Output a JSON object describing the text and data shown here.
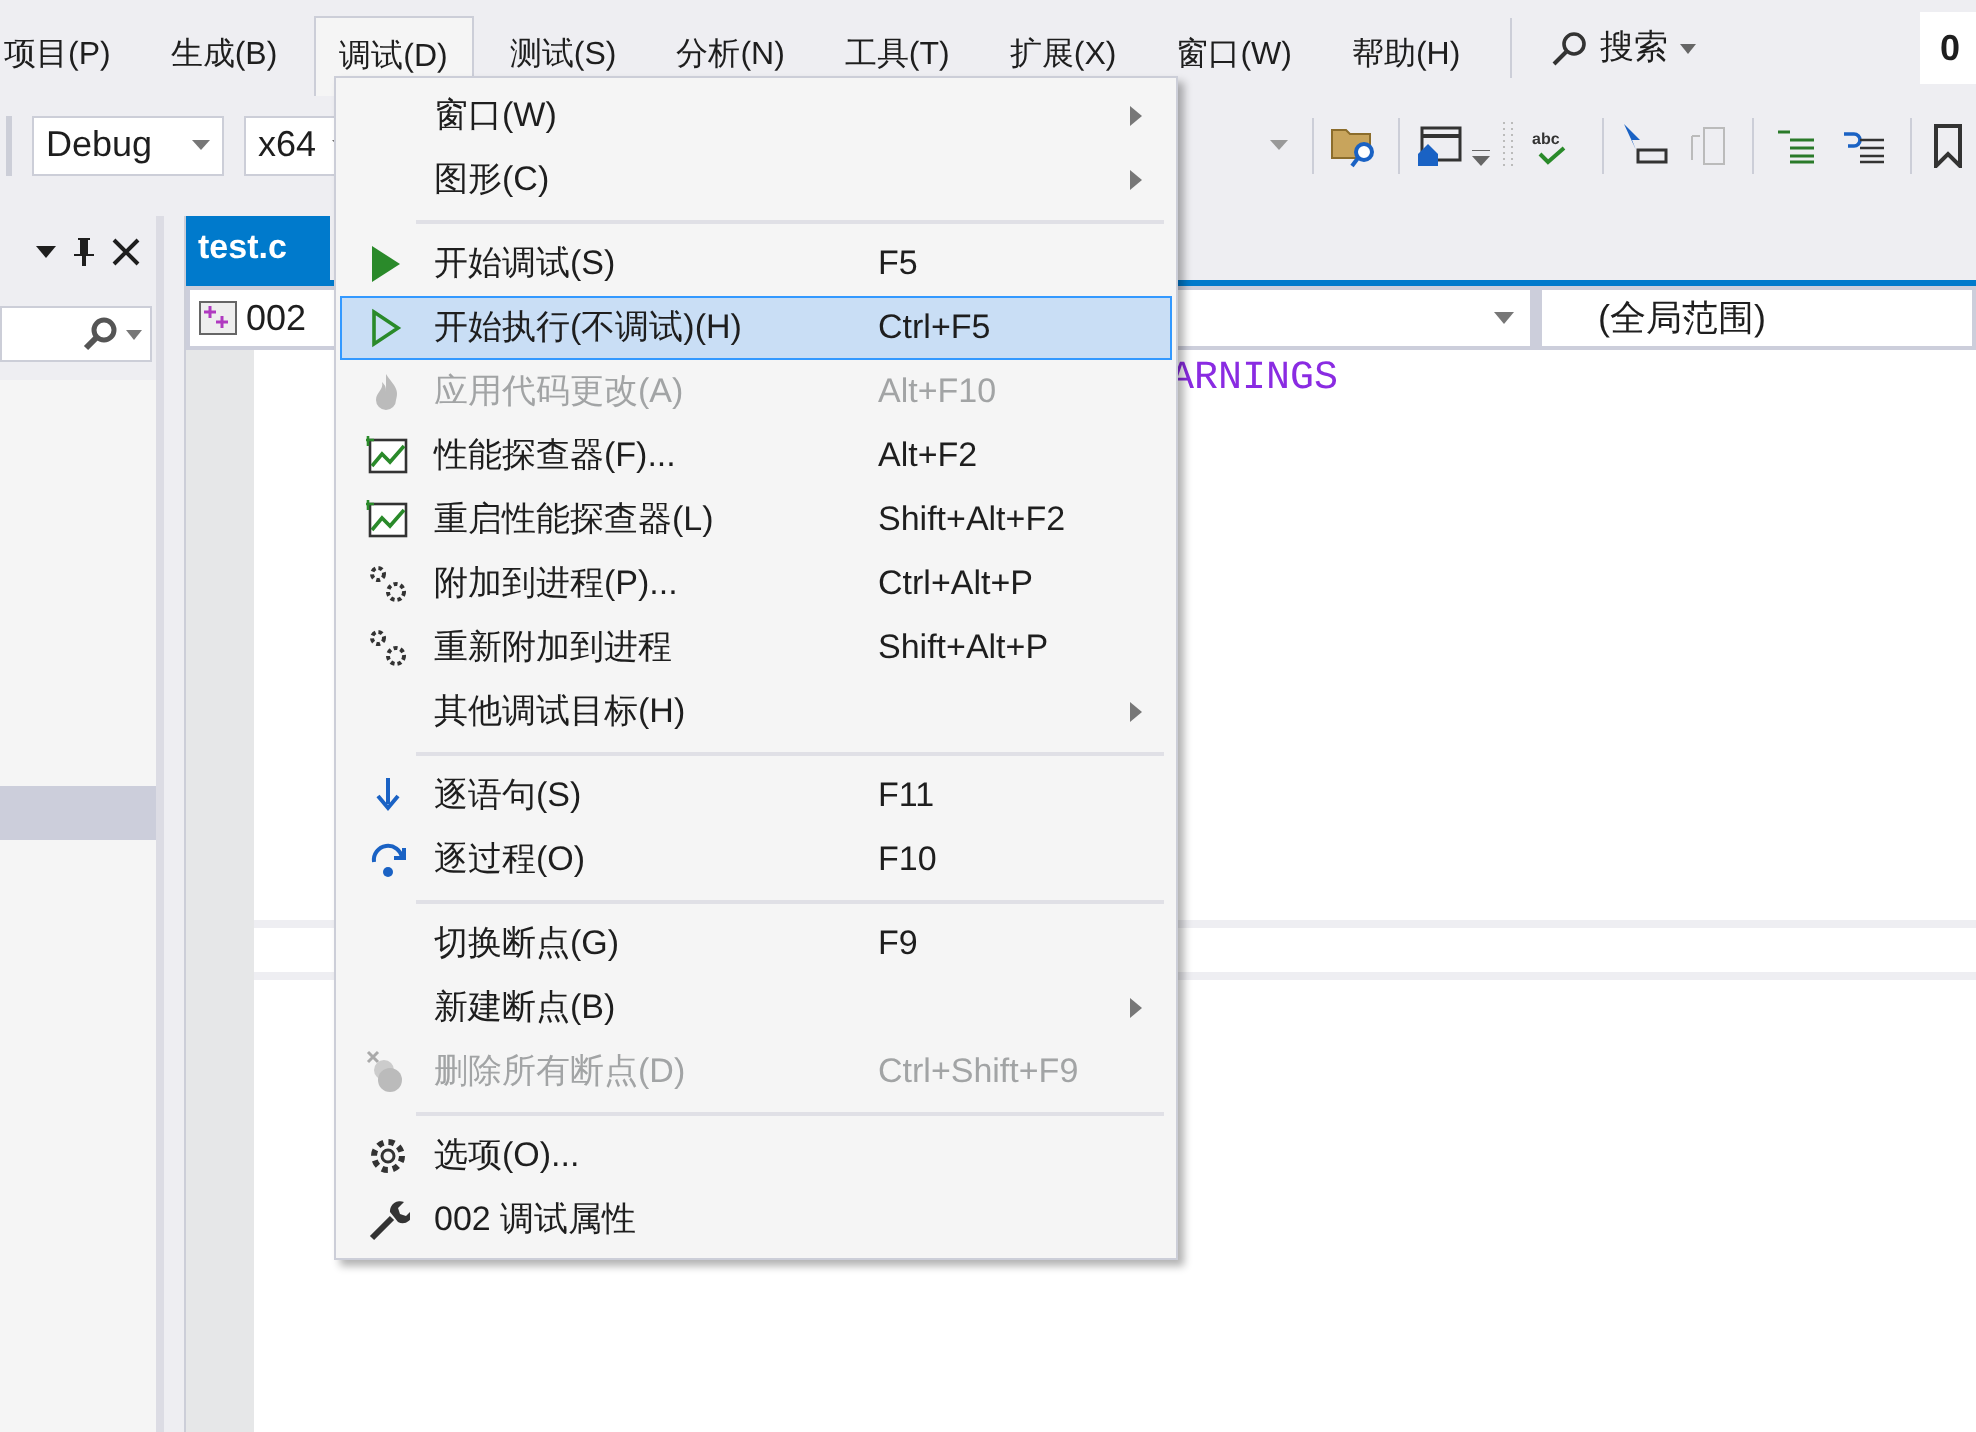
{
  "menu_bar": [
    {
      "label": "项目(P)",
      "selected": false
    },
    {
      "label": "生成(B)",
      "selected": false
    },
    {
      "label": "调试(D)",
      "selected": true
    },
    {
      "label": "测试(S)",
      "selected": false
    },
    {
      "label": "分析(N)",
      "selected": false
    },
    {
      "label": "工具(T)",
      "selected": false
    },
    {
      "label": "扩展(X)",
      "selected": false
    },
    {
      "label": "窗口(W)",
      "selected": false
    },
    {
      "label": "帮助(H)",
      "selected": false
    }
  ],
  "search": {
    "label": "搜索"
  },
  "title_field": {
    "value": "0"
  },
  "toolbar": {
    "configuration": "Debug",
    "platform": "x64",
    "spell_check_label": "abc"
  },
  "document_tab": {
    "label": "test.c",
    "selected": true
  },
  "navigation_bar": {
    "project": "002",
    "scope": "(全局范围)"
  },
  "editor": {
    "visible_code": "ARNINGS"
  },
  "debug_menu": [
    {
      "kind": "item",
      "label": "窗口(W)",
      "submenu": true,
      "disabled": false,
      "selected": false
    },
    {
      "kind": "item",
      "label": "图形(C)",
      "submenu": true,
      "disabled": false,
      "selected": false
    },
    {
      "kind": "separator"
    },
    {
      "kind": "item",
      "label": "开始调试(S)",
      "shortcut": "F5",
      "disabled": false,
      "selected": false
    },
    {
      "kind": "item",
      "label": "开始执行(不调试)(H)",
      "shortcut": "Ctrl+F5",
      "disabled": false,
      "selected": true
    },
    {
      "kind": "item",
      "label": "应用代码更改(A)",
      "shortcut": "Alt+F10",
      "disabled": true,
      "selected": false
    },
    {
      "kind": "item",
      "label": "性能探查器(F)...",
      "shortcut": "Alt+F2",
      "disabled": false,
      "selected": false
    },
    {
      "kind": "item",
      "label": "重启性能探查器(L)",
      "shortcut": "Shift+Alt+F2",
      "disabled": false,
      "selected": false
    },
    {
      "kind": "item",
      "label": "附加到进程(P)...",
      "shortcut": "Ctrl+Alt+P",
      "disabled": false,
      "selected": false
    },
    {
      "kind": "item",
      "label": "重新附加到进程",
      "shortcut": "Shift+Alt+P",
      "disabled": false,
      "selected": false
    },
    {
      "kind": "item",
      "label": "其他调试目标(H)",
      "submenu": true,
      "disabled": false,
      "selected": false
    },
    {
      "kind": "separator"
    },
    {
      "kind": "item",
      "label": "逐语句(S)",
      "shortcut": "F11",
      "disabled": false,
      "selected": false
    },
    {
      "kind": "item",
      "label": "逐过程(O)",
      "shortcut": "F10",
      "disabled": false,
      "selected": false
    },
    {
      "kind": "separator"
    },
    {
      "kind": "item",
      "label": "切换断点(G)",
      "shortcut": "F9",
      "disabled": false,
      "selected": false
    },
    {
      "kind": "item",
      "label": "新建断点(B)",
      "submenu": true,
      "disabled": false,
      "selected": false
    },
    {
      "kind": "item",
      "label": "删除所有断点(D)",
      "shortcut": "Ctrl+Shift+F9",
      "disabled": true,
      "selected": false
    },
    {
      "kind": "separator"
    },
    {
      "kind": "item",
      "label": "选项(O)...",
      "disabled": false,
      "selected": false
    },
    {
      "kind": "item",
      "label": "002 调试属性",
      "disabled": false,
      "selected": false
    }
  ]
}
